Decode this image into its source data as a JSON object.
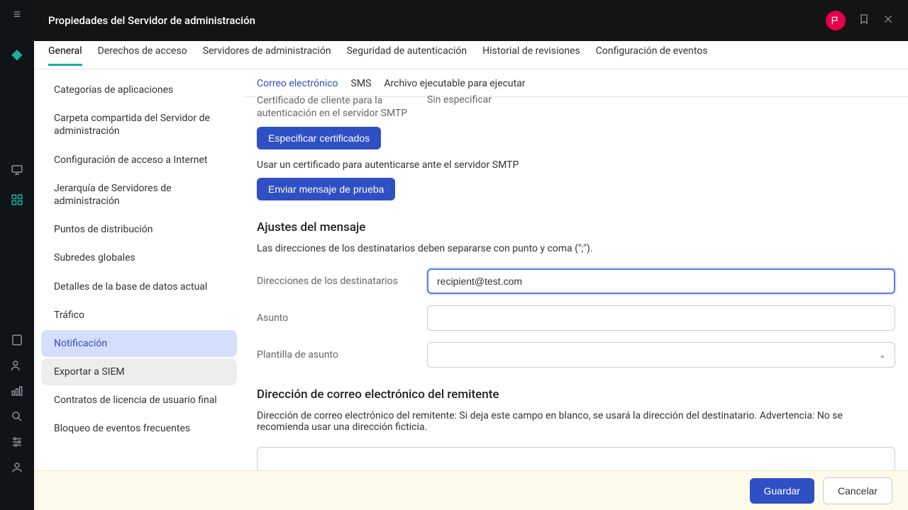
{
  "header": {
    "title": "Propiedades del Servidor de administración"
  },
  "tabs": [
    "General",
    "Derechos de acceso",
    "Servidores de administración",
    "Seguridad de autenticación",
    "Historial de revisiones",
    "Configuración de eventos"
  ],
  "activeTab": 0,
  "sidebar": {
    "items": [
      "Categorías de aplicaciones",
      "Carpeta compartida del Servidor de administración",
      "Configuración de acceso a Internet",
      "Jerarquía de Servidores de administración",
      "Puntos de distribución",
      "Subredes globales",
      "Detalles de la base de datos actual",
      "Tráfico",
      "Notificación",
      "Exportar a SIEM",
      "Contratos de licencia de usuario final",
      "Bloqueo de eventos frecuentes"
    ],
    "selectedIndex": 8,
    "hoverIndex": 9
  },
  "subtabs": [
    "Correo electrónico",
    "SMS",
    "Archivo ejecutable para ejecutar"
  ],
  "activeSubtab": 0,
  "cert": {
    "label": "Certificado de cliente para la autenticación en el servidor SMTP",
    "value": "Sin especificar",
    "button": "Especificar certificados"
  },
  "useCertNote": "Usar un certificado para autenticarse ante el servidor SMTP",
  "testButton": "Enviar mensaje de prueba",
  "messageSettings": {
    "heading": "Ajustes del mensaje",
    "hint": "Las direcciones de los destinatarios deben separarse con punto y coma (\";\").",
    "recipientsLabel": "Direcciones de los destinatarios",
    "recipientsValue": "recipient@test.com",
    "subjectLabel": "Asunto",
    "subjectValue": "",
    "templateLabel": "Plantilla de asunto",
    "templateValue": ""
  },
  "sender": {
    "heading": "Dirección de correo electrónico del remitente",
    "note": "Dirección de correo electrónico del remitente: Si deja este campo en blanco, se usará la dirección del destinatario. Advertencia: No se recomienda usar una dirección ficticia.",
    "value": ""
  },
  "footer": {
    "save": "Guardar",
    "cancel": "Cancelar"
  }
}
